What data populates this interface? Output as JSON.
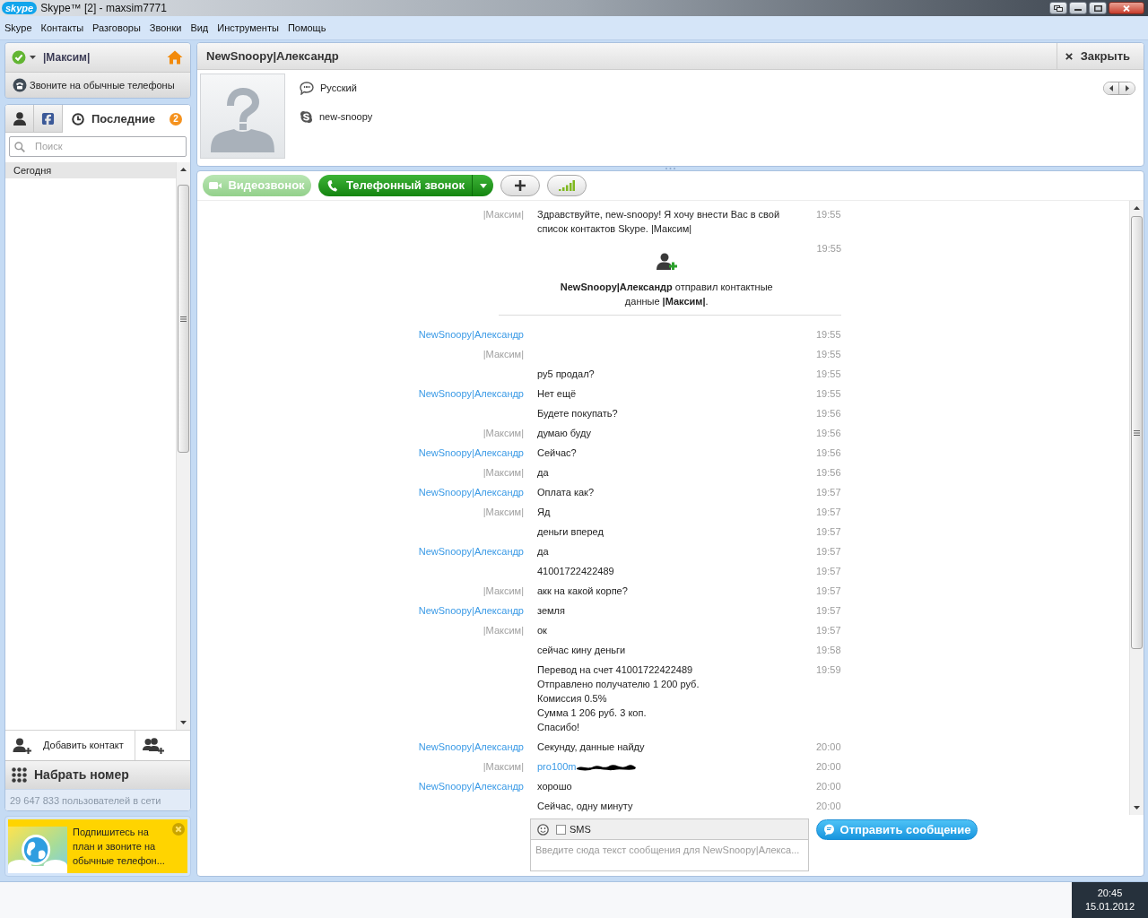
{
  "window": {
    "logo_text": "skype",
    "title": "Skype™ [2] - maxsim7771"
  },
  "menu": [
    "Skype",
    "Контакты",
    "Разговоры",
    "Звонки",
    "Вид",
    "Инструменты",
    "Помощь"
  ],
  "profile": {
    "name": "|Максим|"
  },
  "call_phones_button": {
    "label": "Звоните на обычные телефоны"
  },
  "sidebar_tabs": [
    {
      "kind": "contacts",
      "selected": false
    },
    {
      "kind": "facebook",
      "selected": false
    },
    {
      "kind": "recent",
      "label": "Последние",
      "selected": true,
      "badge": "2"
    }
  ],
  "search": {
    "placeholder": "Поиск"
  },
  "recent_group": "Сегодня",
  "add_contact": {
    "label": "Добавить контакт"
  },
  "dial": {
    "label": "Набрать номер"
  },
  "online_count": "29 647 833 пользователей в сети",
  "promo": {
    "text": "Подпишитесь на план и звоните на обычные телефон..."
  },
  "conversation": {
    "title": "NewSnoopy|Александр",
    "close_label": "Закрыть",
    "language": "Русский",
    "skype_name": "new-snoopy"
  },
  "call_toolbar": {
    "video": {
      "label": "Видеозвонок",
      "disabled": true
    },
    "phone": {
      "label": "Телефонный звонок"
    }
  },
  "messages": [
    {
      "kind": "text",
      "sender": "|Максим|",
      "outgoing": true,
      "text": "Здравствуйте, new-snoopy! Я хочу внести Вас в свой список контактов Skype. |Максим|",
      "time": "19:55"
    },
    {
      "kind": "system",
      "text": "**NewSnoopy|Александр** отправил контактные данные **|Максим|**.",
      "time": "19:55"
    },
    {
      "kind": "text",
      "sender": "NewSnoopy|Александр",
      "outgoing": false,
      "time": "19:55"
    },
    {
      "kind": "text",
      "sender": "|Максим|",
      "outgoing": true,
      "time": "19:55"
    },
    {
      "kind": "text",
      "text": "ру5 продал?",
      "time": "19:55"
    },
    {
      "kind": "text",
      "sender": "NewSnoopy|Александр",
      "outgoing": false,
      "text": "Нет ещё",
      "time": "19:55"
    },
    {
      "kind": "text",
      "text": "Будете покупать?",
      "time": "19:56"
    },
    {
      "kind": "text",
      "sender": "|Максим|",
      "outgoing": true,
      "text": "думаю буду",
      "time": "19:56"
    },
    {
      "kind": "text",
      "sender": "NewSnoopy|Александр",
      "outgoing": false,
      "text": "Сейчас?",
      "time": "19:56"
    },
    {
      "kind": "text",
      "sender": "|Максим|",
      "outgoing": true,
      "text": "да",
      "time": "19:56"
    },
    {
      "kind": "text",
      "sender": "NewSnoopy|Александр",
      "outgoing": false,
      "text": "Оплата как?",
      "time": "19:57"
    },
    {
      "kind": "text",
      "sender": "|Максим|",
      "outgoing": true,
      "text": "Яд",
      "time": "19:57"
    },
    {
      "kind": "text",
      "text": "деньги вперед",
      "time": "19:57"
    },
    {
      "kind": "text",
      "sender": "NewSnoopy|Александр",
      "outgoing": false,
      "text": "да",
      "time": "19:57"
    },
    {
      "kind": "text",
      "text": "41001722422489",
      "time": "19:57"
    },
    {
      "kind": "text",
      "sender": "|Максим|",
      "outgoing": true,
      "text": "акк на какой корпе?",
      "time": "19:57"
    },
    {
      "kind": "text",
      "sender": "NewSnoopy|Александр",
      "outgoing": false,
      "text": "земля",
      "time": "19:57"
    },
    {
      "kind": "text",
      "sender": "|Максим|",
      "outgoing": true,
      "text": "ок",
      "time": "19:57"
    },
    {
      "kind": "text",
      "text": "сейчас кину деньги",
      "time": "19:58"
    },
    {
      "kind": "text",
      "lines": [
        "Перевод на счет 41001722422489",
        "Отправлено получателю 1 200 руб.",
        "Комиссия 0.5%",
        "Сумма 1 206 руб. 3 коп.",
        "Спасибо!"
      ],
      "time": "19:59"
    },
    {
      "kind": "text",
      "sender": "NewSnoopy|Александр",
      "outgoing": false,
      "text": "Секунду, данные найду",
      "time": "20:00"
    },
    {
      "kind": "link",
      "sender": "|Максим|",
      "outgoing": true,
      "text": "pro100m",
      "redacted": true,
      "time": "20:00"
    },
    {
      "kind": "text",
      "sender": "NewSnoopy|Александр",
      "outgoing": false,
      "text": "хорошо",
      "time": "20:00"
    },
    {
      "kind": "text",
      "text": "Сейчас, одну минуту",
      "time": "20:00"
    }
  ],
  "composer": {
    "sms": {
      "label": "SMS",
      "checked": false
    },
    "placeholder": "Введите сюда текст сообщения для NewSnoopy|Алекса...",
    "send_label": "Отправить сообщение"
  },
  "taskbar": {
    "time": "20:45",
    "date": "15.01.2012"
  }
}
